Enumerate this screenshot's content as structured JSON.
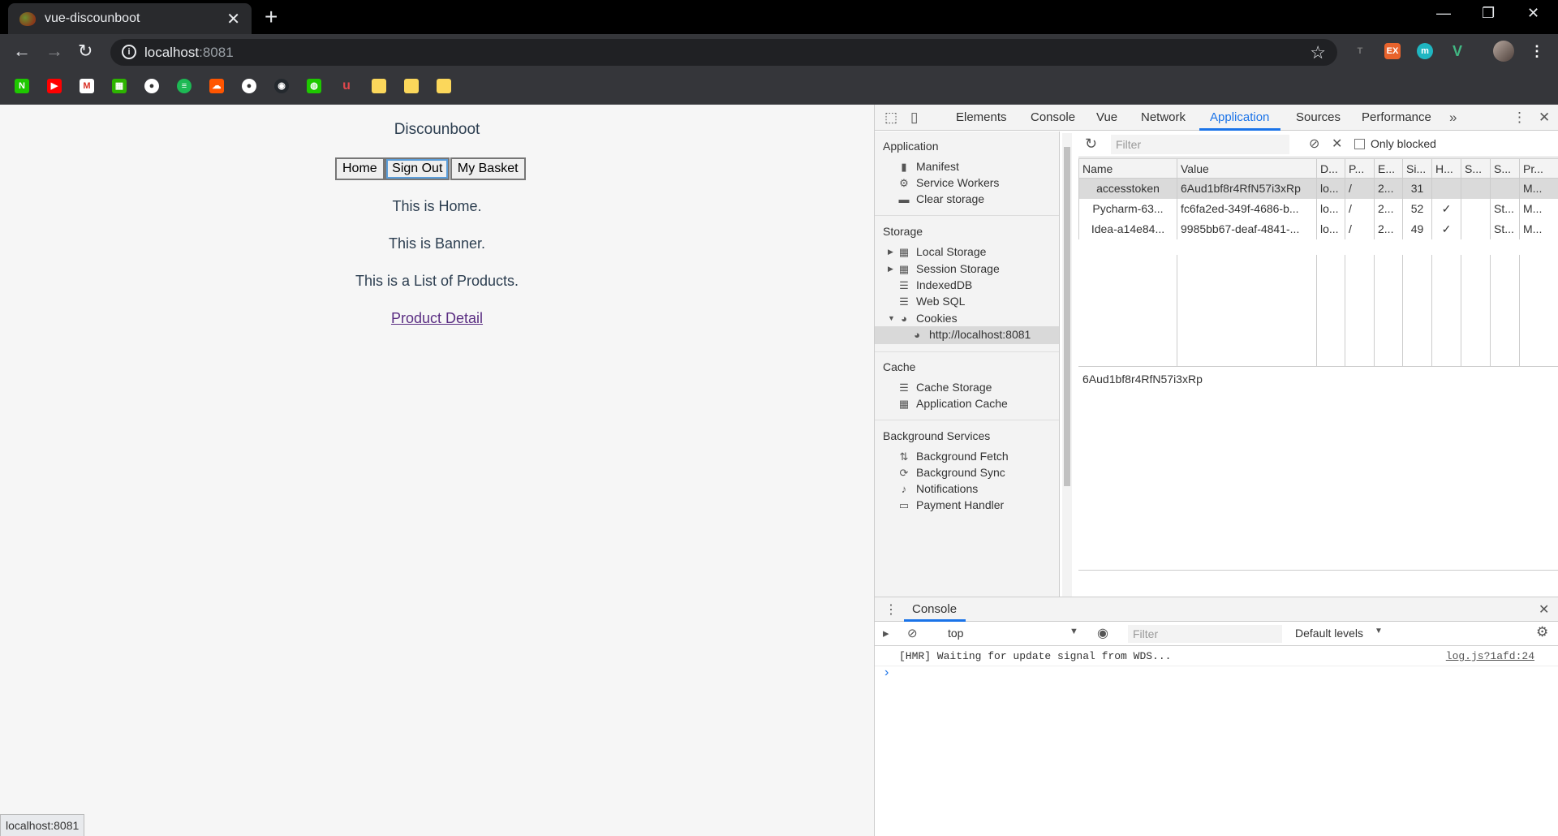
{
  "browser": {
    "tab_title": "vue-discounboot",
    "url_host": "localhost",
    "url_port": ":8081",
    "status_url": "localhost:8081",
    "extensions": [
      "T",
      "EX",
      "m",
      "V"
    ],
    "colors": {
      "title_bg": "#000000",
      "toolbar_bg": "#35363a",
      "omnibox_bg": "#202124"
    }
  },
  "page": {
    "brand": "Discounboot",
    "nav": {
      "home": "Home",
      "sign_out": "Sign Out",
      "basket": "My Basket"
    },
    "home_text": "This is Home.",
    "banner_text": "This is Banner.",
    "products_text": "This is a List of Products.",
    "product_link": "Product Detail"
  },
  "devtools": {
    "tabs": [
      "Elements",
      "Console",
      "Vue",
      "Network",
      "Application",
      "Sources",
      "Performance"
    ],
    "active_tab": "Application",
    "sidebar": {
      "application_header": "Application",
      "application_items": [
        "Manifest",
        "Service Workers",
        "Clear storage"
      ],
      "storage_header": "Storage",
      "storage_items": [
        "Local Storage",
        "Session Storage",
        "IndexedDB",
        "Web SQL",
        "Cookies"
      ],
      "cookie_origin": "http://localhost:8081",
      "cache_header": "Cache",
      "cache_items": [
        "Cache Storage",
        "Application Cache"
      ],
      "bg_header": "Background Services",
      "bg_items": [
        "Background Fetch",
        "Background Sync",
        "Notifications",
        "Payment Handler"
      ]
    },
    "cookie_toolbar": {
      "filter_placeholder": "Filter",
      "only_blocked": "Only blocked"
    },
    "cookie_columns": [
      "Name",
      "Value",
      "D...",
      "P...",
      "E...",
      "Si...",
      "H...",
      "S...",
      "S...",
      "Pr..."
    ],
    "cookies": [
      [
        "accesstoken",
        "6Aud1bf8r4RfN57i3xRp",
        "lo...",
        "/",
        "2...",
        "31",
        "",
        "",
        "",
        "M..."
      ],
      [
        "Pycharm-63...",
        "fc6fa2ed-349f-4686-b...",
        "lo...",
        "/",
        "2...",
        "52",
        "✓",
        "",
        "St...",
        "M..."
      ],
      [
        "Idea-a14e84...",
        "9985bb67-deaf-4841-...",
        "lo...",
        "/",
        "2...",
        "49",
        "✓",
        "",
        "St...",
        "M..."
      ]
    ],
    "selected_cookie_value": "6Aud1bf8r4RfN57i3xRp",
    "drawer": {
      "tab": "Console",
      "context": "top",
      "filter_placeholder": "Filter",
      "levels": "Default levels",
      "message": "[HMR] Waiting for update signal from WDS...",
      "source": "log.js?1afd:24",
      "prompt": "›"
    }
  }
}
